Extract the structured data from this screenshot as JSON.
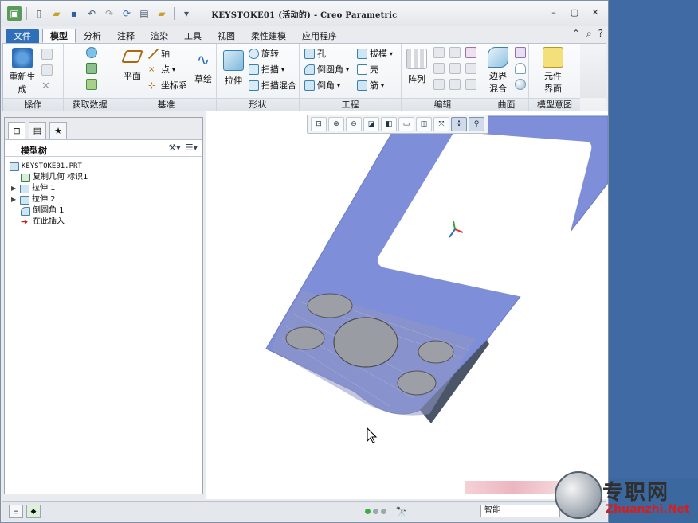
{
  "window": {
    "title": "KEYSTOKE01 (活动的) - Creo Parametric"
  },
  "tabs": [
    "文件",
    "模型",
    "分析",
    "注释",
    "渲染",
    "工具",
    "视图",
    "柔性建模",
    "应用程序"
  ],
  "active_tab": "模型",
  "ribbon": {
    "groups": {
      "operate": "操作",
      "get_data": "获取数据",
      "datum": "基准",
      "shape": "形状",
      "engineering": "工程",
      "edit": "编辑",
      "surface": "曲面",
      "model_intent": "模型意图"
    },
    "regenerate_line1": "重新生",
    "regenerate_line2": "成",
    "plane": "平面",
    "axis": "轴",
    "point": "点",
    "csys": "坐标系",
    "sketch": "草绘",
    "extrude": "拉伸",
    "revolve": "旋转",
    "sweep": "扫描",
    "swept_blend": "扫描混合",
    "hole": "孔",
    "round": "倒圆角",
    "chamfer": "倒角",
    "draft": "拔模",
    "shell": "壳",
    "rib": "筋",
    "pattern": "阵列",
    "boundary_line1": "边界",
    "boundary_line2": "混合",
    "component_line1": "元件",
    "component_line2": "界面"
  },
  "model_tree": {
    "header": "模型树",
    "nodes": [
      {
        "label": "KEYSTOKE01.PRT"
      },
      {
        "label": "复制几何 标识1"
      },
      {
        "label": "拉伸 1"
      },
      {
        "label": "拉伸 2"
      },
      {
        "label": "倒圆角 1"
      },
      {
        "label": "在此插入"
      }
    ]
  },
  "status": {
    "filter": "智能"
  },
  "watermark": {
    "cn": "专职网",
    "en": "Zhuanzhi.Net"
  },
  "colors": {
    "part_blue": "#7f8ed8",
    "accent_file_tab": "#2f6fb8",
    "desktop_blue": "#3f6aa4",
    "watermark_red": "#d21f1f"
  }
}
